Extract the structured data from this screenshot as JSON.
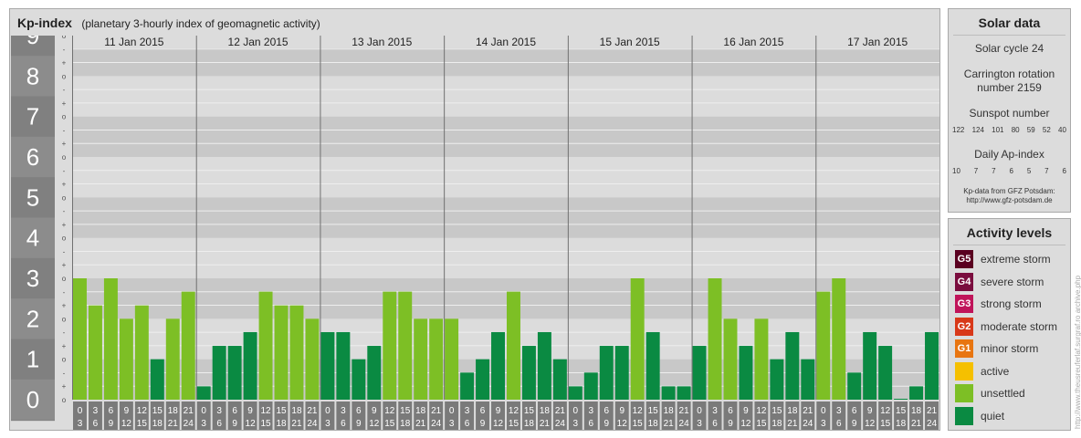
{
  "header": {
    "title": "Kp-index",
    "subtitle": "(planetary 3-hourly index of geomagnetic activity)"
  },
  "chart_data": {
    "type": "bar",
    "title": "Kp-index",
    "subtitle": "(planetary 3-hourly index of geomagnetic activity)",
    "ylim": [
      0,
      9
    ],
    "y_ticks": [
      "0",
      "1",
      "2",
      "3",
      "4",
      "5",
      "6",
      "7",
      "8",
      "9"
    ],
    "minor_tick_labels": [
      "o",
      "+",
      "-"
    ],
    "days": [
      "11 Jan 2015",
      "12 Jan 2015",
      "13 Jan 2015",
      "14 Jan 2015",
      "15 Jan 2015",
      "16 Jan 2015",
      "17 Jan 2015"
    ],
    "interval_start_hours": [
      "0",
      "3",
      "6",
      "9",
      "12",
      "15",
      "18",
      "21"
    ],
    "interval_end_hours": [
      "3",
      "6",
      "9",
      "12",
      "15",
      "18",
      "21",
      "24"
    ],
    "values": [
      [
        3.0,
        2.33,
        3.0,
        2.0,
        2.33,
        1.0,
        2.0,
        2.67
      ],
      [
        0.33,
        1.33,
        1.33,
        1.67,
        2.67,
        2.33,
        2.33,
        2.0
      ],
      [
        1.67,
        1.67,
        1.0,
        1.33,
        2.67,
        2.67,
        2.0,
        2.0
      ],
      [
        2.0,
        0.67,
        1.0,
        1.67,
        2.67,
        1.33,
        1.67,
        1.0
      ],
      [
        0.33,
        0.67,
        1.33,
        1.33,
        3.0,
        1.67,
        0.33,
        0.33
      ],
      [
        1.33,
        3.0,
        2.0,
        1.33,
        2.0,
        1.0,
        1.67,
        1.0
      ],
      [
        2.67,
        3.0,
        0.67,
        1.67,
        1.33,
        0.0,
        0.33,
        1.67
      ]
    ],
    "colors": {
      "quiet": "#0a8a42",
      "unsettled": "#7dbf25",
      "band_dark": "#c8c8c8",
      "band_light": "#dcdcdc",
      "gridline": "#eeeeee",
      "axis_box": "#808080",
      "hour_box": "#7a7a7a"
    }
  },
  "solar": {
    "title": "Solar data",
    "cycle": "Solar cycle 24",
    "carrington_line1": "Carrington rotation",
    "carrington_line2": "number 2159",
    "sunspot_label": "Sunspot number",
    "sunspot_values": [
      "122",
      "124",
      "101",
      "80",
      "59",
      "52",
      "40"
    ],
    "ap_label": "Daily Ap-index",
    "ap_values": [
      "10",
      "7",
      "7",
      "6",
      "5",
      "7",
      "6"
    ],
    "source_line1": "Kp-data from GFZ Potsdam:",
    "source_line2": "http://www.gfz-potsdam.de"
  },
  "activity": {
    "title": "Activity levels",
    "levels": [
      {
        "code": "G5",
        "label": "extreme storm",
        "color": "#5a0020"
      },
      {
        "code": "G4",
        "label": "severe storm",
        "color": "#7a0d3e"
      },
      {
        "code": "G3",
        "label": "strong storm",
        "color": "#c0145a"
      },
      {
        "code": "G2",
        "label": "moderate storm",
        "color": "#d83818"
      },
      {
        "code": "G1",
        "label": "minor storm",
        "color": "#e87510"
      },
      {
        "code": "",
        "label": "active",
        "color": "#f5c000"
      },
      {
        "code": "",
        "label": "unsettled",
        "color": "#7dbf25"
      },
      {
        "code": "",
        "label": "quiet",
        "color": "#0a8a42"
      }
    ]
  },
  "credit": "http://www.theusreuferlaf.surgraf.ro archive.php"
}
